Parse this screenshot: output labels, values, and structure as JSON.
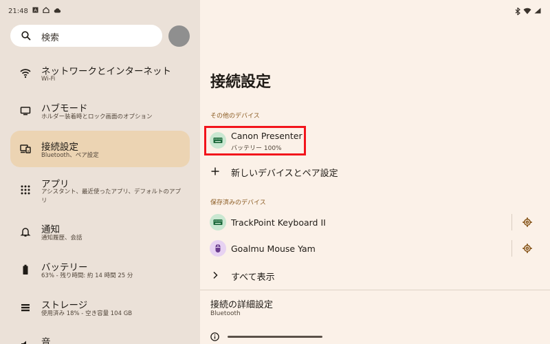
{
  "status_bar": {
    "time": "21:48"
  },
  "search": {
    "placeholder": "検索"
  },
  "sidebar": {
    "items": [
      {
        "title": "ネットワークとインターネット",
        "subtitle": "Wi-Fi",
        "icon": "wifi-icon",
        "selected": false
      },
      {
        "title": "ハブモード",
        "subtitle": "ホルダー装着時とロック画面のオプション",
        "icon": "hub-icon",
        "selected": false
      },
      {
        "title": "接続設定",
        "subtitle": "Bluetooth、ペア設定",
        "icon": "connected-devices-icon",
        "selected": true
      },
      {
        "title": "アプリ",
        "subtitle": "アシスタント、最近使ったアプリ、デフォルトのアプリ",
        "icon": "apps-grid-icon",
        "selected": false
      },
      {
        "title": "通知",
        "subtitle": "通知履歴、会話",
        "icon": "bell-icon",
        "selected": false
      },
      {
        "title": "バッテリー",
        "subtitle": "63% - 残り時間: 約 14 時間 25 分",
        "icon": "battery-icon",
        "selected": false
      },
      {
        "title": "ストレージ",
        "subtitle": "使用済み 18% - 空き容量 104 GB",
        "icon": "storage-icon",
        "selected": false
      },
      {
        "title": "音",
        "subtitle": "",
        "icon": "volume-icon",
        "selected": false
      }
    ]
  },
  "main": {
    "title": "接続設定",
    "other_devices_label": "その他のデバイス",
    "other_devices": [
      {
        "name": "Canon Presenter",
        "status": "バッテリー 100%",
        "icon": "keyboard-icon",
        "highlighted": true
      }
    ],
    "pair_new_label": "新しいデバイスとペア設定",
    "saved_devices_label": "保存済みのデバイス",
    "saved_devices": [
      {
        "name": "TrackPoint Keyboard II",
        "icon": "keyboard-icon"
      },
      {
        "name": "Goalmu Mouse Yam",
        "icon": "mouse-icon"
      }
    ],
    "see_all_label": "すべて表示",
    "advanced": {
      "title": "接続の詳細設定",
      "subtitle": "Bluetooth"
    }
  },
  "colors": {
    "left_bg": "#ebe1d8",
    "right_bg": "#fbf1e8",
    "selected_bg": "#ecd4b3",
    "accent_label": "#8a5a20",
    "highlight": "#f2131b",
    "keyboard_chip": "#c9e7d1",
    "mouse_chip": "#e7d2f2"
  }
}
